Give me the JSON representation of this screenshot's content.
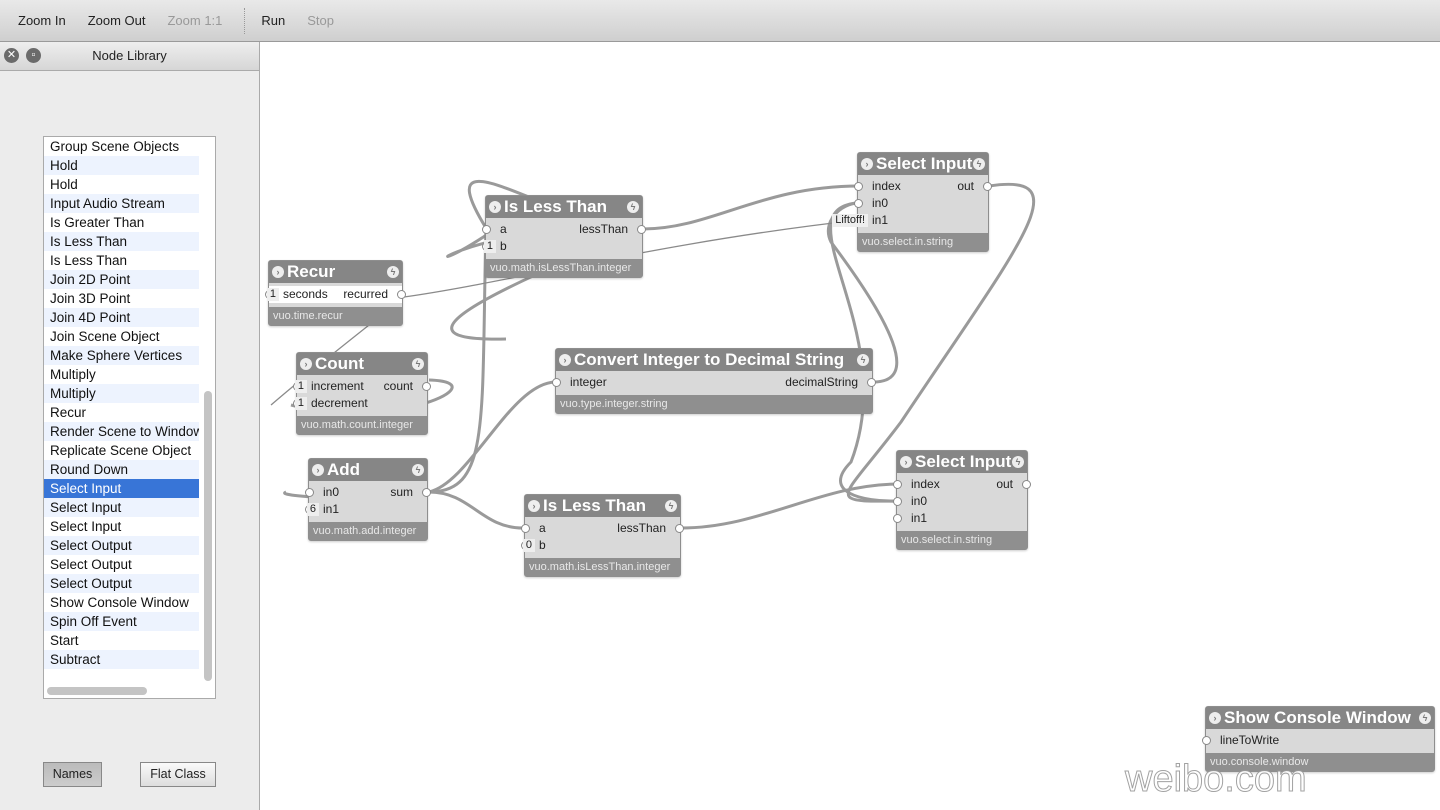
{
  "toolbar": {
    "items": [
      {
        "label": "Zoom In",
        "enabled": true
      },
      {
        "label": "Zoom Out",
        "enabled": true
      },
      {
        "label": "Zoom 1:1",
        "enabled": false
      },
      {
        "label": "Run",
        "enabled": true
      },
      {
        "label": "Stop",
        "enabled": false
      }
    ]
  },
  "sidebar": {
    "title": "Node Library",
    "close_icon": "close-icon",
    "detach_icon": "window-icon",
    "items": [
      "Group Scene Objects",
      "Hold",
      "Hold",
      "Input Audio Stream",
      "Is Greater Than",
      "Is Less Than",
      "Is Less Than",
      "Join 2D Point",
      "Join 3D Point",
      "Join 4D Point",
      "Join Scene Object",
      "Make Sphere Vertices",
      "Multiply",
      "Multiply",
      "Recur",
      "Render Scene to Window",
      "Replicate Scene Object",
      "Round Down",
      "Select Input",
      "Select Input",
      "Select Input",
      "Select Output",
      "Select Output",
      "Select Output",
      "Show Console Window",
      "Spin Off Event",
      "Start",
      "Subtract"
    ],
    "selected_index": 18,
    "buttons": {
      "names": "Names",
      "flat_class": "Flat Class"
    }
  },
  "nodes": [
    {
      "title": "Recur",
      "class": "vuo.time.recur",
      "rows": [
        {
          "in": "seconds",
          "value": "1",
          "out": "recurred"
        }
      ]
    },
    {
      "title": "Count",
      "class": "vuo.math.count.integer",
      "rows": [
        {
          "in": "increment",
          "value": "1",
          "out": "count"
        },
        {
          "in": "decrement",
          "value": "1"
        }
      ]
    },
    {
      "title": "Add",
      "class": "vuo.math.add.integer",
      "rows": [
        {
          "in": "in0",
          "out": "sum"
        },
        {
          "in": "in1",
          "value": "6"
        }
      ]
    },
    {
      "title": "Is Less Than",
      "class": "vuo.math.isLessThan.integer",
      "rows": [
        {
          "in": "a",
          "out": "lessThan"
        },
        {
          "in": "b",
          "value": "1"
        }
      ]
    },
    {
      "title": "Convert Integer to Decimal String",
      "class": "vuo.type.integer.string",
      "rows": [
        {
          "in": "integer",
          "out": "decimalString"
        }
      ]
    },
    {
      "title": "Is Less Than",
      "class": "vuo.math.isLessThan.integer",
      "rows": [
        {
          "in": "a",
          "out": "lessThan"
        },
        {
          "in": "b",
          "value": "0"
        }
      ]
    },
    {
      "title": "Select Input",
      "class": "vuo.select.in.string",
      "rows": [
        {
          "in": "index",
          "out": "out"
        },
        {
          "in": "in0"
        },
        {
          "in": "in1",
          "value": "Liftoff!"
        }
      ]
    },
    {
      "title": "Select Input",
      "class": "vuo.select.in.string",
      "rows": [
        {
          "in": "index",
          "out": "out"
        },
        {
          "in": "in0"
        },
        {
          "in": "in1"
        }
      ]
    },
    {
      "title": "Show Console Window",
      "class": "vuo.console.window",
      "rows": [
        {
          "in": "lineToWrite"
        }
      ]
    }
  ],
  "watermark": "weibo.com"
}
